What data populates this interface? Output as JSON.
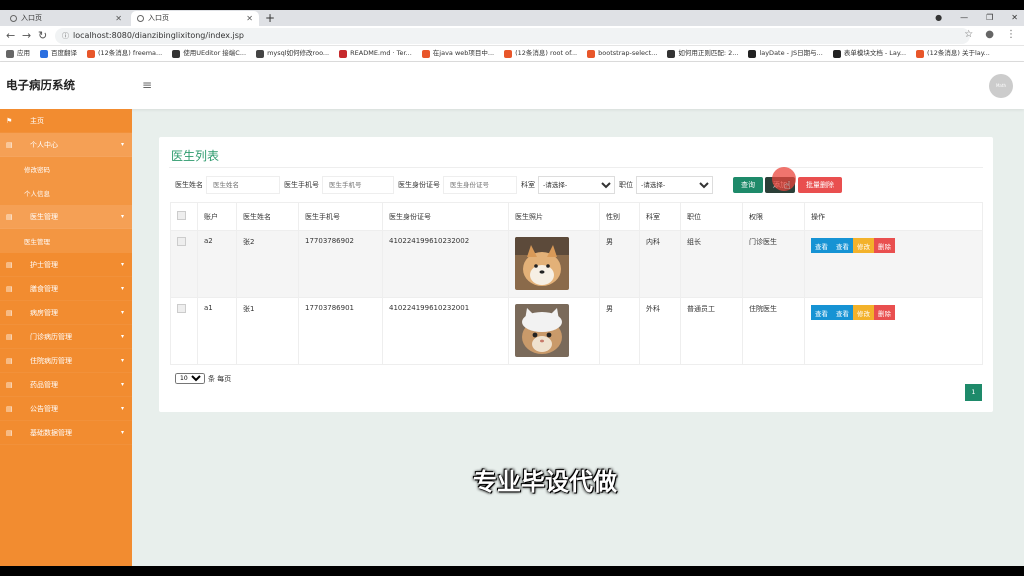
{
  "browser": {
    "tabs": [
      {
        "label": "入口页",
        "active": false
      },
      {
        "label": "入口页",
        "active": true
      }
    ],
    "url": "localhost:8080/dianzibinglixitong/index.jsp",
    "bookmarks": [
      {
        "label": "应用",
        "color": "#666666"
      },
      {
        "label": "百度翻译",
        "color": "#2b6fe0"
      },
      {
        "label": "(12条消息) freema...",
        "color": "#e8562a"
      },
      {
        "label": "使用UEditor 接端C...",
        "color": "#333333"
      },
      {
        "label": "mysql如何修改roo...",
        "color": "#444444"
      },
      {
        "label": "README.md · Ter...",
        "color": "#c6292c"
      },
      {
        "label": "在java web项目中...",
        "color": "#e8562a"
      },
      {
        "label": "(12条消息) root of...",
        "color": "#e8562a"
      },
      {
        "label": "bootstrap-select...",
        "color": "#e8562a"
      },
      {
        "label": "如何用正则匹配: 2...",
        "color": "#333333"
      },
      {
        "label": "layDate - JS日期与...",
        "color": "#222222"
      },
      {
        "label": "表单模块文档 - Lay...",
        "color": "#222222"
      },
      {
        "label": "(12条消息) 关于lay...",
        "color": "#e8562a"
      }
    ]
  },
  "header": {
    "brand": "电子病历系统",
    "avatar_text": "Math"
  },
  "sidebar": {
    "items": [
      {
        "label": "主页",
        "icon": "flag-icon",
        "has_arrow": false
      },
      {
        "label": "个人中心",
        "icon": "grid-icon",
        "has_arrow": true,
        "open": true,
        "children": [
          "修改密码",
          "个人信息"
        ]
      },
      {
        "label": "医生管理",
        "icon": "grid-icon",
        "has_arrow": true,
        "open": true,
        "children": [
          "医生管理"
        ]
      },
      {
        "label": "护士管理",
        "icon": "grid-icon",
        "has_arrow": true
      },
      {
        "label": "膳食管理",
        "icon": "grid-icon",
        "has_arrow": true
      },
      {
        "label": "病房管理",
        "icon": "grid-icon",
        "has_arrow": true
      },
      {
        "label": "门诊病历管理",
        "icon": "grid-icon",
        "has_arrow": true
      },
      {
        "label": "住院病历管理",
        "icon": "grid-icon",
        "has_arrow": true
      },
      {
        "label": "药品管理",
        "icon": "grid-icon",
        "has_arrow": true
      },
      {
        "label": "公告管理",
        "icon": "grid-icon",
        "has_arrow": true
      },
      {
        "label": "基础数据管理",
        "icon": "grid-icon",
        "has_arrow": true
      }
    ]
  },
  "panel": {
    "title": "医生列表",
    "search": {
      "name_label": "医生姓名",
      "name_placeholder": "医生姓名",
      "phone_label": "医生手机号",
      "phone_placeholder": "医生手机号",
      "id_label": "医生身份证号",
      "id_placeholder": "医生身份证号",
      "dept_label": "科室",
      "dept_value": "-请选择-",
      "pos_label": "职位",
      "pos_value": "-请选择-",
      "query_btn": "查询",
      "add_btn": "添加",
      "batch_delete_btn": "批量删除"
    },
    "columns": [
      "账户",
      "医生姓名",
      "医生手机号",
      "医生身份证号",
      "医生照片",
      "性别",
      "科室",
      "职位",
      "权限",
      "操作"
    ],
    "rows": [
      {
        "account": "a2",
        "name": "张2",
        "phone": "17703786902",
        "idcard": "410224199610232002",
        "gender": "男",
        "dept": "内科",
        "position": "组长",
        "role": "门诊医生"
      },
      {
        "account": "a1",
        "name": "张1",
        "phone": "17703786901",
        "idcard": "410224199610232001",
        "gender": "男",
        "dept": "外科",
        "position": "普通员工",
        "role": "住院医生"
      }
    ],
    "ops": [
      "查看",
      "查看",
      "修改",
      "删除"
    ],
    "pager": {
      "page_size": "10",
      "per_page_label": "条 每页",
      "current_page": "1"
    }
  },
  "caption": "专业毕设代做"
}
